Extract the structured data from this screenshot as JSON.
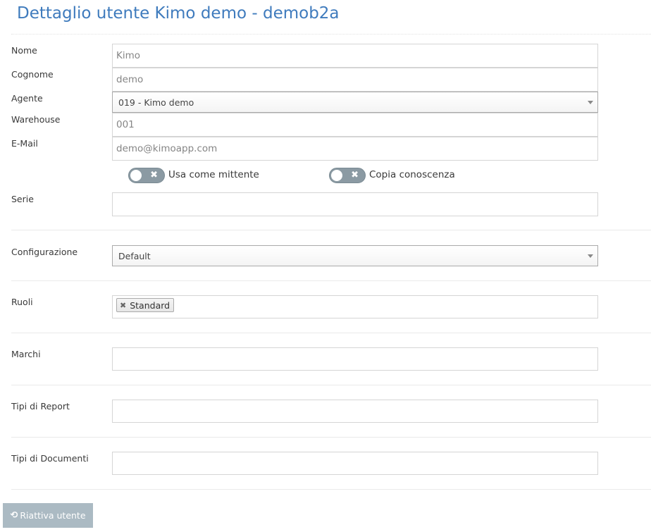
{
  "page": {
    "title": "Dettaglio utente Kimo demo - demob2a"
  },
  "form": {
    "nome": {
      "label": "Nome",
      "value": "Kimo"
    },
    "cognome": {
      "label": "Cognome",
      "value": "demo"
    },
    "agente": {
      "label": "Agente",
      "value": "019 - Kimo demo"
    },
    "warehouse": {
      "label": "Warehouse",
      "value": "001"
    },
    "email": {
      "label": "E-Mail",
      "value": "demo@kimoapp.com"
    },
    "toggles": {
      "usa_mittente": {
        "label": "Usa come mittente",
        "checked": false,
        "icon": "close-icon"
      },
      "copia_conoscenza": {
        "label": "Copia conoscenza",
        "checked": false,
        "icon": "close-icon"
      }
    },
    "serie": {
      "label": "Serie",
      "value": ""
    },
    "configurazione": {
      "label": "Configurazione",
      "value": "Default"
    },
    "ruoli": {
      "label": "Ruoli",
      "tags": [
        "Standard"
      ],
      "tag_remove_icon": "close-icon"
    },
    "marchi": {
      "label": "Marchi",
      "value": ""
    },
    "tipi_report": {
      "label": "Tipi di Report",
      "value": ""
    },
    "tipi_documenti": {
      "label": "Tipi di Documenti",
      "value": ""
    }
  },
  "actions": {
    "riattiva_label": "Riattiva utente",
    "riattiva_icon": "undo-icon"
  },
  "colors": {
    "title": "#3f7bbd",
    "button": "#abbac3",
    "switch_off": "#8b9aa3"
  }
}
